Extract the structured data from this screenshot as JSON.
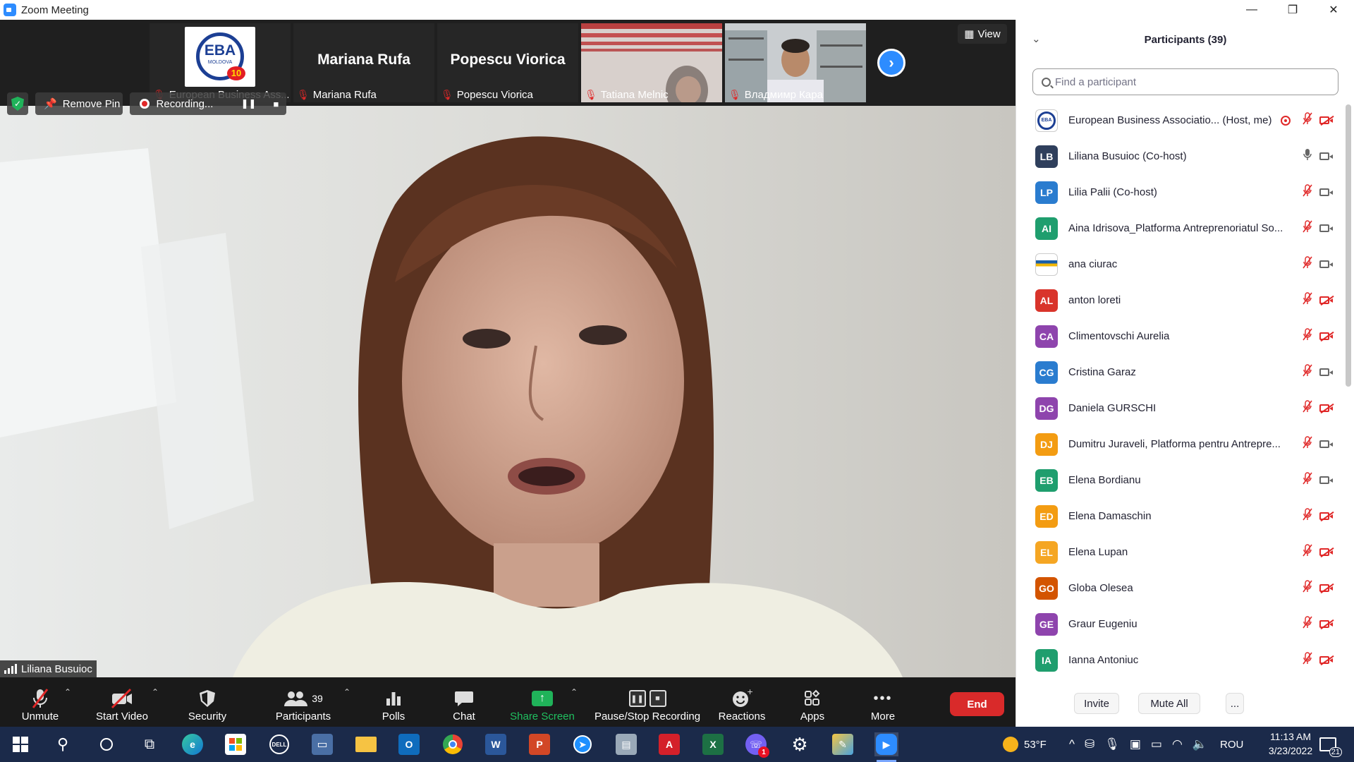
{
  "window": {
    "title": "Zoom Meeting",
    "controls": [
      "—",
      "❐",
      "✕"
    ]
  },
  "thumbnails": [
    {
      "label": "European Business Ass...",
      "type": "logo",
      "logo_text": "EBA",
      "logo_sub": "MOLDOVA",
      "logo_badge": "10"
    },
    {
      "label": "Mariana Rufa",
      "type": "name",
      "big_name": "Mariana Rufa"
    },
    {
      "label": "Popescu Viorica",
      "type": "name",
      "big_name": "Popescu Viorica"
    },
    {
      "label": "Tatiana Melnic",
      "type": "video"
    },
    {
      "label": "Владмимр Кара",
      "type": "video"
    }
  ],
  "view_button": {
    "label": "View"
  },
  "overlay": {
    "remove_pin": "Remove Pin",
    "recording": "Recording...",
    "speaker": "Liliana Busuioc"
  },
  "toolbar": {
    "unmute": "Unmute",
    "start_video": "Start Video",
    "security": "Security",
    "participants": "Participants",
    "participants_count": "39",
    "polls": "Polls",
    "chat": "Chat",
    "share_screen": "Share Screen",
    "pause_stop": "Pause/Stop Recording",
    "reactions": "Reactions",
    "apps": "Apps",
    "more": "More",
    "end": "End"
  },
  "panel": {
    "title": "Participants (39)",
    "search_placeholder": "Find a participant",
    "participants": [
      {
        "initials": "",
        "avatar": "logo",
        "name": "European Business Associatio... (Host, me)",
        "mic": "muted",
        "cam": "off",
        "recording": true
      },
      {
        "initials": "LB",
        "color": "#2f3f5c",
        "name": "Liliana Busuioc (Co-host)",
        "mic": "on",
        "cam": "on"
      },
      {
        "initials": "LP",
        "color": "#2a7ccf",
        "name": "Lilia Palii (Co-host)",
        "mic": "muted",
        "cam": "on"
      },
      {
        "initials": "AI",
        "color": "#1f9e6e",
        "name": "Aina Idrisova_Platforma Antreprenoriatul So...",
        "mic": "muted",
        "cam": "on"
      },
      {
        "initials": "",
        "avatar": "stripe",
        "name": "ana ciurac",
        "mic": "muted",
        "cam": "on"
      },
      {
        "initials": "AL",
        "color": "#d9342b",
        "name": "anton loreti",
        "mic": "muted",
        "cam": "off"
      },
      {
        "initials": "CA",
        "color": "#8e44ad",
        "name": "Climentovschi Aurelia",
        "mic": "muted",
        "cam": "off"
      },
      {
        "initials": "CG",
        "color": "#2a7ccf",
        "name": "Cristina Garaz",
        "mic": "muted",
        "cam": "on"
      },
      {
        "initials": "DG",
        "color": "#8e44ad",
        "name": "Daniela GURSCHI",
        "mic": "muted",
        "cam": "off"
      },
      {
        "initials": "DJ",
        "color": "#f39c12",
        "name": "Dumitru Juraveli, Platforma pentru Antrepre...",
        "mic": "muted",
        "cam": "on"
      },
      {
        "initials": "EB",
        "color": "#1f9e6e",
        "name": "Elena Bordianu",
        "mic": "muted",
        "cam": "on"
      },
      {
        "initials": "ED",
        "color": "#f39c12",
        "name": "Elena Damaschin",
        "mic": "muted",
        "cam": "off"
      },
      {
        "initials": "EL",
        "color": "#f5a623",
        "name": "Elena Lupan",
        "mic": "muted",
        "cam": "off"
      },
      {
        "initials": "GO",
        "color": "#d35400",
        "name": "Globa Olesea",
        "mic": "muted",
        "cam": "off"
      },
      {
        "initials": "GE",
        "color": "#8e44ad",
        "name": "Graur Eugeniu",
        "mic": "muted",
        "cam": "off"
      },
      {
        "initials": "IA",
        "color": "#1f9e6e",
        "name": "Ianna Antoniuc",
        "mic": "muted",
        "cam": "off"
      }
    ],
    "invite": "Invite",
    "mute_all": "Mute All",
    "more": "..."
  },
  "taskbar": {
    "weather": "53°F",
    "language": "ROU",
    "time": "11:13 AM",
    "date": "3/23/2022",
    "notification_count": "21",
    "viber_badge": "1"
  },
  "icons": [
    "windows-icon",
    "search-icon",
    "cortana-icon",
    "task-view-icon",
    "edge-icon",
    "store-icon",
    "dell-icon",
    "devices-icon",
    "file-explorer-icon",
    "outlook-icon",
    "chrome-icon",
    "word-icon",
    "powerpoint-icon",
    "browser-icon",
    "files-icon",
    "acrobat-icon",
    "excel-icon",
    "viber-icon",
    "settings-icon",
    "paint-icon",
    "zoom-icon"
  ],
  "colors": {
    "accent": "#2d8cff",
    "end": "#d92a2a",
    "share": "#20b35a",
    "muted": "#e02828",
    "taskbar": "#1b2a4a"
  }
}
